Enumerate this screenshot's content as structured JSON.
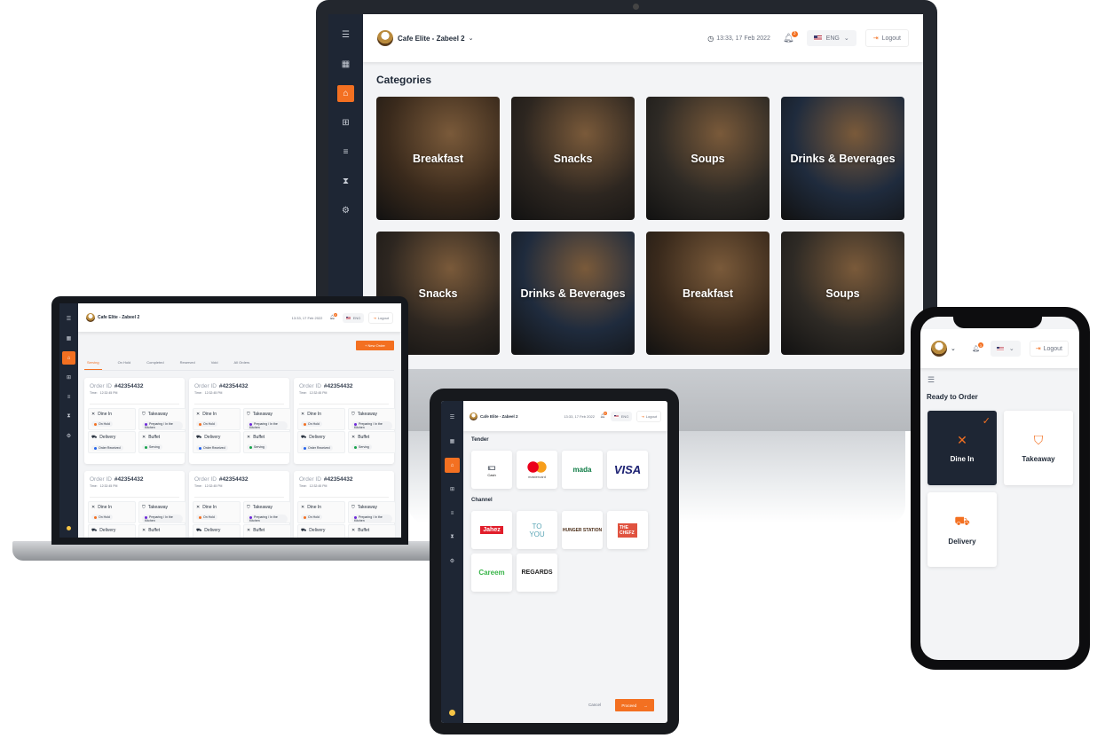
{
  "app": {
    "restaurant": "Cafe Elite - Zabeel 2",
    "datetime": "13:33, 17 Feb 2022",
    "notifications": "3",
    "language": "ENG",
    "logout": "Logout",
    "accent": "#f37021",
    "sidebar_bg": "#1e2634"
  },
  "sidebar_icons": [
    "menu-icon",
    "building-icon",
    "basket-icon",
    "table-icon",
    "list-icon",
    "hourglass-icon",
    "gear-icon"
  ],
  "monitor": {
    "title": "Categories",
    "categories": [
      {
        "label": "Breakfast",
        "color": "#3a2a1c"
      },
      {
        "label": "Snacks",
        "color": "#2d2620"
      },
      {
        "label": "Soups",
        "color": "#2e2a25"
      },
      {
        "label": "Drinks & Beverages",
        "color": "#1f2b3d"
      },
      {
        "label": "Snacks",
        "color": "#2d2620"
      },
      {
        "label": "Drinks & Beverages",
        "color": "#1f2b3d"
      },
      {
        "label": "Breakfast",
        "color": "#3a2a1c"
      },
      {
        "label": "Soups",
        "color": "#2e2a25"
      }
    ]
  },
  "laptop": {
    "new_order": "+ New Order",
    "tabs": [
      "Serving",
      "On Hold",
      "Completed",
      "Reserved",
      "Void",
      "All Orders"
    ],
    "active_tab": "Serving",
    "order_label": "Order ID",
    "time_label": "Time:",
    "orders": [
      {
        "id": "#42354432",
        "time": "12:32:45 PM"
      },
      {
        "id": "#42354432",
        "time": "12:32:45 PM"
      },
      {
        "id": "#42354432",
        "time": "12:32:45 PM"
      },
      {
        "id": "#42354432",
        "time": "12:32:45 PM"
      },
      {
        "id": "#42354432",
        "time": "12:32:45 PM"
      },
      {
        "id": "#42354432",
        "time": "12:32:45 PM"
      }
    ],
    "order_types": [
      {
        "label": "Dine In",
        "icon": "fork-knife-icon",
        "status": "On Hold",
        "color": "#f37021"
      },
      {
        "label": "Takeaway",
        "icon": "bag-icon",
        "status": "Preparing / In the Kitchen",
        "color": "#6d28d9"
      },
      {
        "label": "Delivery",
        "icon": "truck-icon",
        "status": "Order Received",
        "color": "#2563eb"
      },
      {
        "label": "Buffet",
        "icon": "fork-knife-icon",
        "status": "Serving",
        "color": "#16a34a"
      }
    ]
  },
  "tablet": {
    "tender_title": "Tender",
    "tender": [
      "Cash",
      "mastercard",
      "mada",
      "VISA"
    ],
    "channel_title": "Channel",
    "channels": [
      "Jahez",
      "TO YOU",
      "HUNGER STATION",
      "THE CHEFZ",
      "Careem",
      "REGARDS"
    ],
    "cancel": "Cancel",
    "proceed": "Proceed"
  },
  "phone": {
    "title": "Ready to Order",
    "options": [
      {
        "label": "Dine In",
        "icon": "fork-knife-icon",
        "selected": true
      },
      {
        "label": "Takeaway",
        "icon": "bag-icon",
        "selected": false
      },
      {
        "label": "Delivery",
        "icon": "truck-icon",
        "selected": false
      }
    ]
  }
}
